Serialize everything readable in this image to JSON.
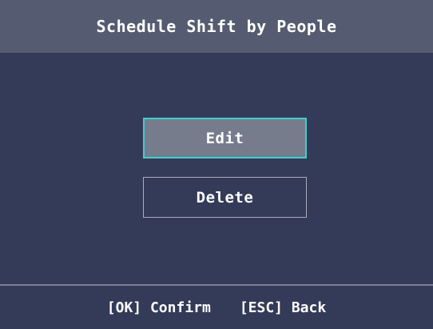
{
  "header": {
    "title": "Schedule Shift by People"
  },
  "menu": {
    "items": [
      {
        "label": "Edit",
        "selected": true
      },
      {
        "label": "Delete",
        "selected": false
      }
    ]
  },
  "footer": {
    "confirm_hint": "[OK] Confirm",
    "back_hint": "[ESC] Back"
  },
  "colors": {
    "background": "#333b58",
    "header": "#555b70",
    "selected_fill": "#767c8c",
    "selected_border": "#3fd0cc"
  }
}
